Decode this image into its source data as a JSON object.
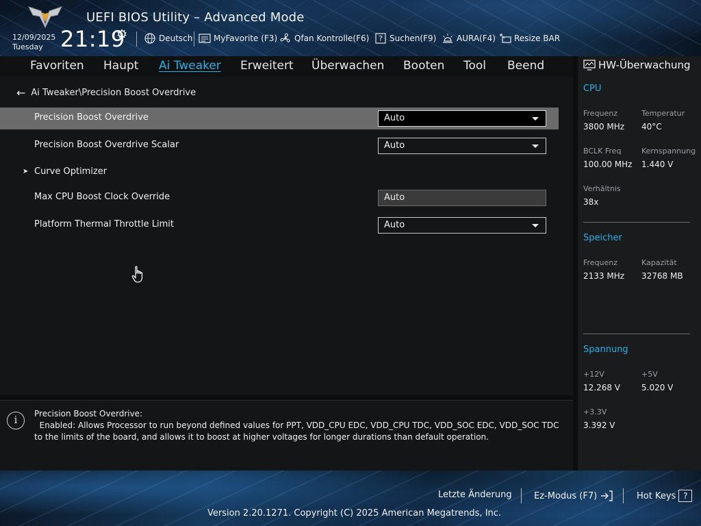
{
  "header": {
    "title": "UEFI BIOS Utility – Advanced Mode",
    "date": "12/09/2025",
    "day": "Tuesday",
    "time": "21:19",
    "items": [
      {
        "label": "Deutsch",
        "icon": "globe-icon"
      },
      {
        "label": "MyFavorite (F3)",
        "icon": "favorite-list-icon"
      },
      {
        "label": "Qfan Kontrolle(F6)",
        "icon": "fan-icon"
      },
      {
        "label": "Suchen(F9)",
        "icon": "search-help-icon"
      },
      {
        "label": "AURA(F4)",
        "icon": "aura-light-icon"
      },
      {
        "label": "Resize BAR",
        "icon": "resize-bar-icon"
      }
    ]
  },
  "tabs": [
    {
      "label": "Favoriten"
    },
    {
      "label": "Haupt"
    },
    {
      "label": "Ai Tweaker",
      "active": true
    },
    {
      "label": "Erweitert"
    },
    {
      "label": "Überwachen"
    },
    {
      "label": "Booten"
    },
    {
      "label": "Tool"
    },
    {
      "label": "Beend"
    }
  ],
  "breadcrumb": "Ai Tweaker\\Precision Boost Overdrive",
  "settings": [
    {
      "label": "Precision Boost Overdrive",
      "value": "Auto",
      "selected": true
    },
    {
      "label": "Precision Boost Overdrive Scalar",
      "value": "Auto"
    },
    {
      "label": "Curve Optimizer",
      "submenu": true
    },
    {
      "label": "Max CPU Boost Clock Override",
      "value": "Auto",
      "disabled": true
    },
    {
      "label": "Platform Thermal Throttle Limit",
      "value": "Auto"
    }
  ],
  "help": {
    "title": "Precision Boost Overdrive:",
    "body": "  Enabled: Allows Processor to run beyond defined values for PPT, VDD_CPU EDC, VDD_CPU TDC, VDD_SOC EDC, VDD_SOC TDC to the limits of the board, and allows it to boost at higher voltages for longer durations than default operation."
  },
  "hw": {
    "title": "HW-Überwachung",
    "cpu": {
      "section": "CPU",
      "freq_label": "Frequenz",
      "freq": "3800 MHz",
      "temp_label": "Temperatur",
      "temp": "40°C",
      "bclk_label": "BCLK Freq",
      "bclk": "100.00 MHz",
      "vcore_label": "Kernspannung",
      "vcore": "1.440 V",
      "ratio_label": "Verhältnis",
      "ratio": "38x"
    },
    "memory": {
      "section": "Speicher",
      "freq_label": "Frequenz",
      "freq": "2133 MHz",
      "cap_label": "Kapazität",
      "cap": "32768 MB"
    },
    "voltage": {
      "section": "Spannung",
      "v12_label": "+12V",
      "v12": "12.268 V",
      "v5_label": "+5V",
      "v5": "5.020 V",
      "v33_label": "+3.3V",
      "v33": "3.392 V"
    }
  },
  "footer": {
    "last_change": "Letzte Änderung",
    "ez_mode": "Ez-Modus (F7)",
    "hot_keys": "Hot Keys",
    "hot_keys_key": "?",
    "copyright": "Version 2.20.1271. Copyright (C) 2025 American Megatrends, Inc."
  },
  "colors": {
    "accent": "#2bb0e6",
    "selected_row": "#6b6b6b"
  }
}
